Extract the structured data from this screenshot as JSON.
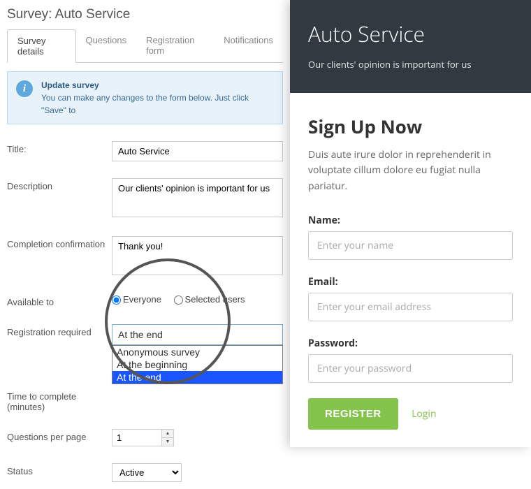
{
  "page": {
    "title_prefix": "Survey:",
    "title_name": "Auto Service"
  },
  "tabs": {
    "t0": "Survey details",
    "t1": "Questions",
    "t2": "Registration form",
    "t3": "Notifications"
  },
  "info": {
    "heading": "Update survey",
    "body": "You can make any changes to the form below. Just click \"Save\" to"
  },
  "form": {
    "title_label": "Title:",
    "title_value": "Auto Service",
    "desc_label": "Description",
    "desc_value": "Our clients' opinion is important for us",
    "conf_label": "Completion confirmation",
    "conf_value": "Thank you!",
    "avail_label": "Available to",
    "avail_everyone": "Everyone",
    "avail_selected": "Selected users",
    "reg_label": "Registration required",
    "reg_display": "At the end",
    "reg_opt0": "Anonymous survey",
    "reg_opt1": "At the beginning",
    "reg_opt2": "At the end",
    "time_label_l1": "Time to complete",
    "time_label_l2": "(minutes)",
    "qpp_label": "Questions per page",
    "qpp_value": "1",
    "status_label": "Status",
    "status_value": "Active"
  },
  "preview": {
    "header_title": "Auto Service",
    "header_sub": "Our clients' opinion is important for us",
    "signup_title": "Sign Up Now",
    "signup_desc": "Duis aute irure dolor in reprehenderit in voluptate cillum dolore eu fugiat nulla pariatur.",
    "name_label": "Name:",
    "name_ph": "Enter your name",
    "email_label": "Email:",
    "email_ph": "Enter your email address",
    "pass_label": "Password:",
    "pass_ph": "Enter your password",
    "register_btn": "REGISTER",
    "login_link": "Login"
  }
}
